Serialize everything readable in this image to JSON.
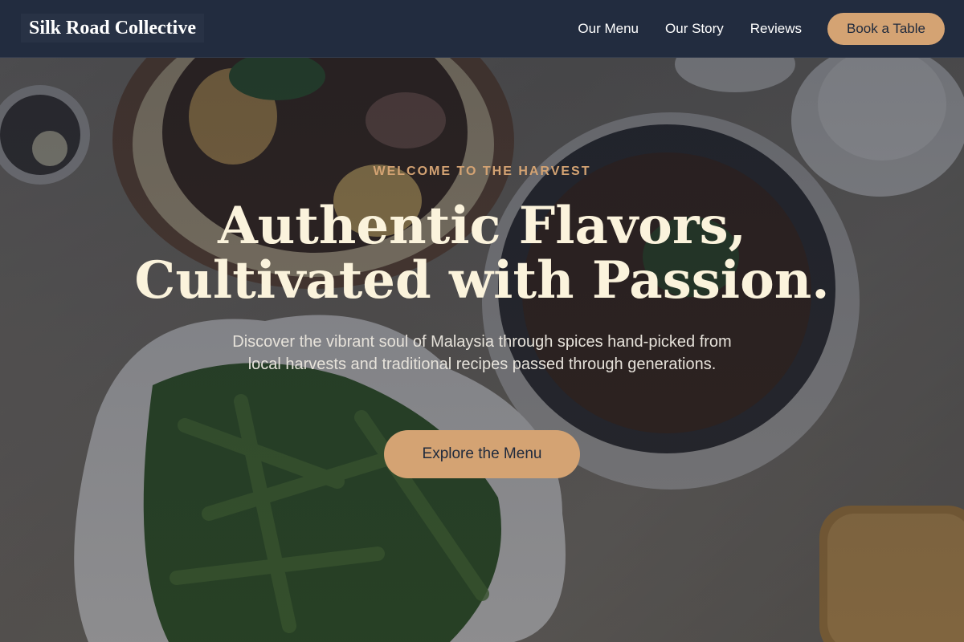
{
  "header": {
    "brand": "Silk Road Collective",
    "nav": [
      {
        "label": "Our Menu"
      },
      {
        "label": "Our Story"
      },
      {
        "label": "Reviews"
      }
    ],
    "cta_label": "Book a Table"
  },
  "hero": {
    "eyebrow": "WELCOME TO THE HARVEST",
    "headline_line1": "Authentic Flavors,",
    "headline_line2": "Cultivated with Passion.",
    "subtext": "Discover the vibrant soul of Malaysia through spices hand-picked from local harvests and traditional recipes passed through generations.",
    "cta_label": "Explore the Menu"
  },
  "colors": {
    "header_bg": "#222c3f",
    "accent": "#d4a373",
    "headline": "#fbf3dc"
  }
}
